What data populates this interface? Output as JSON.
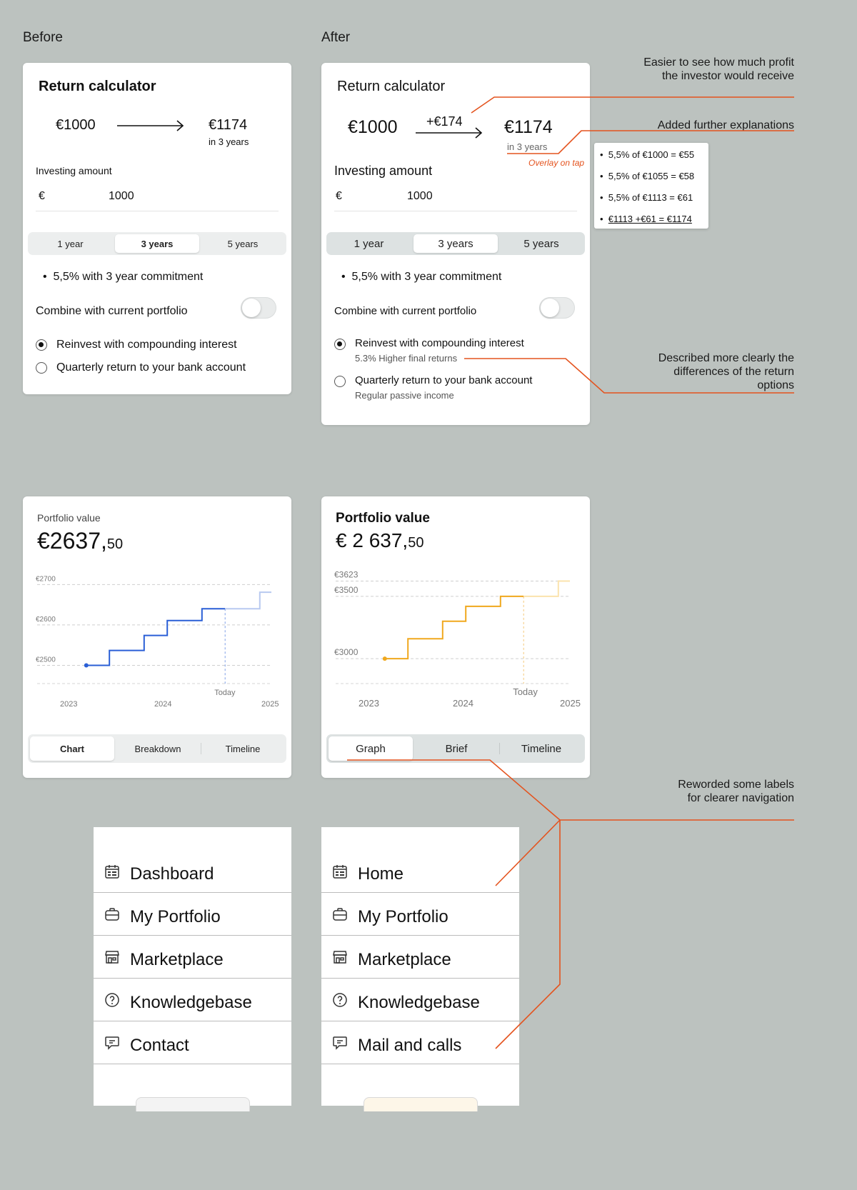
{
  "labels": {
    "before": "Before",
    "after": "After"
  },
  "calc_before": {
    "title": "Return calculator",
    "start_amount": "€1000",
    "end_amount": "€1174",
    "period_text": "in 3 years",
    "investing_label": "Investing amount",
    "currency": "€",
    "amount_value": "1000",
    "periods": [
      "1 year",
      "3 years",
      "5 years"
    ],
    "selected_period": "3 years",
    "rate_text": "5,5% with 3 year commitment",
    "combine_label": "Combine with current portfolio",
    "combine_on": false,
    "option_reinvest": "Reinvest with compounding interest",
    "option_quarterly": "Quarterly return to your bank account",
    "selected_option": "reinvest"
  },
  "calc_after": {
    "title": "Return calculator",
    "start_amount": "€1000",
    "gain": "+€174",
    "end_amount": "€1174",
    "period_text": "in 3 years",
    "overlay_note": "Overlay on tap",
    "investing_label": "Investing amount",
    "currency": "€",
    "amount_value": "1000",
    "periods": [
      "1 year",
      "3 years",
      "5 years"
    ],
    "selected_period": "3 years",
    "rate_text": "5,5% with 3 year commitment",
    "combine_label": "Combine with current portfolio",
    "combine_on": false,
    "option_reinvest": "Reinvest with compounding interest",
    "option_reinvest_sub": "5.3% Higher final returns",
    "option_quarterly": "Quarterly return to your bank account",
    "option_quarterly_sub": "Regular passive income",
    "selected_option": "reinvest",
    "breakdown": [
      "5,5% of €1000 = €55",
      "5,5% of €1055 = €58",
      "5,5% of €1113 = €61",
      "€1113 +€61 = €1174"
    ]
  },
  "portfolio_before": {
    "label": "Portfolio value",
    "value_main": "€2637,",
    "value_cents": "50",
    "tabs": [
      "Chart",
      "Breakdown",
      "Timeline"
    ],
    "selected_tab": "Chart",
    "today_label": "Today",
    "color": "#2a5fd6",
    "color_future": "#b8c9f0"
  },
  "portfolio_after": {
    "label": "Portfolio value",
    "value_main": "€ 2 637,",
    "value_cents": "50",
    "tabs": [
      "Graph",
      "Brief",
      "Timeline"
    ],
    "selected_tab": "Graph",
    "today_label": "Today",
    "color": "#f0a81e",
    "color_future": "#fbe3ad"
  },
  "chart_data": [
    {
      "type": "line",
      "step": true,
      "title": "",
      "x_ticks": [
        "2023",
        "2024",
        "2025"
      ],
      "y_ticks": [
        "€2700",
        "€2600",
        "€2500"
      ],
      "y_tick_values": [
        2700,
        2600,
        2500
      ],
      "ylim": [
        2455,
        2720
      ],
      "xlim": [
        2023.0,
        2025.0
      ],
      "today_x": 2024.6,
      "series": [
        {
          "x": [
            2023.4,
            2023.6,
            2023.6,
            2023.9,
            2023.9,
            2024.1,
            2024.1,
            2024.4,
            2024.4,
            2024.6
          ],
          "y": [
            2500,
            2500,
            2537,
            2537,
            2574,
            2574,
            2611,
            2611,
            2640,
            2640
          ]
        },
        {
          "x": [
            2024.6,
            2024.9,
            2024.9,
            2025.0
          ],
          "y": [
            2640,
            2640,
            2681,
            2681
          ]
        }
      ],
      "grid": true
    },
    {
      "type": "line",
      "step": true,
      "title": "",
      "x_ticks": [
        "2023",
        "2024",
        "2025"
      ],
      "y_ticks": [
        "€3623",
        "€3500",
        "€3000"
      ],
      "y_tick_values": [
        3623,
        3500,
        3000
      ],
      "ylim": [
        2800,
        3660
      ],
      "xlim": [
        2023.0,
        2025.0
      ],
      "today_x": 2024.6,
      "series": [
        {
          "x": [
            2023.4,
            2023.6,
            2023.6,
            2023.9,
            2023.9,
            2024.1,
            2024.1,
            2024.4,
            2024.4,
            2024.6
          ],
          "y": [
            3000,
            3000,
            3160,
            3160,
            3300,
            3300,
            3420,
            3420,
            3500,
            3500
          ]
        },
        {
          "x": [
            2024.6,
            2024.9,
            2024.9,
            2025.0
          ],
          "y": [
            3500,
            3500,
            3623,
            3623
          ]
        }
      ],
      "grid": true
    }
  ],
  "nav_before": {
    "items": [
      {
        "label": "Dashboard",
        "icon": "calendar-icon"
      },
      {
        "label": "My Portfolio",
        "icon": "briefcase-icon"
      },
      {
        "label": "Marketplace",
        "icon": "store-icon"
      },
      {
        "label": "Knowledgebase",
        "icon": "help-circle-icon"
      },
      {
        "label": "Contact",
        "icon": "chat-icon"
      }
    ]
  },
  "nav_after": {
    "items": [
      {
        "label": "Home",
        "icon": "calendar-icon"
      },
      {
        "label": "My Portfolio",
        "icon": "briefcase-icon"
      },
      {
        "label": "Marketplace",
        "icon": "store-icon"
      },
      {
        "label": "Knowledgebase",
        "icon": "help-circle-icon"
      },
      {
        "label": "Mail and calls",
        "icon": "chat-icon"
      }
    ]
  },
  "annotations": {
    "profit": "Easier to see how much profit the investor would receive",
    "explanations": "Added further explanations",
    "return_options": "Described more clearly the differences of the return options",
    "labels": "Reworded some labels for clearer navigation",
    "color": "#e4531e"
  }
}
